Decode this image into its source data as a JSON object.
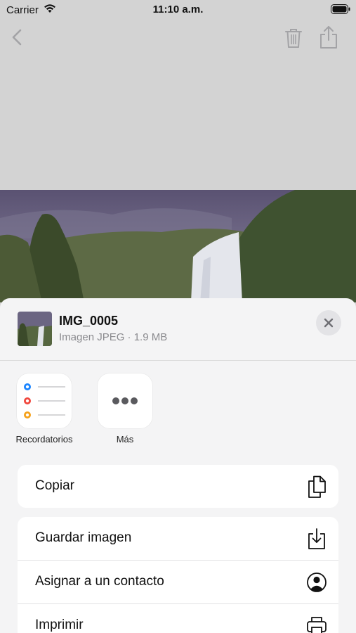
{
  "status_bar": {
    "carrier": "Carrier",
    "time": "11:10 a.m."
  },
  "navbar": {
    "back_icon": "chevron-left-icon",
    "trash_icon": "trash-icon",
    "share_icon": "share-icon"
  },
  "share_sheet": {
    "file_name": "IMG_0005",
    "file_meta": "Imagen JPEG · 1.9 MB",
    "apps": [
      {
        "label": "Recordatorios",
        "icon": "reminders-icon"
      },
      {
        "label": "Más",
        "icon": "more-icon"
      }
    ],
    "actions_group1": [
      {
        "label": "Copiar",
        "icon": "copy-icon"
      }
    ],
    "actions_group2": [
      {
        "label": "Guardar imagen",
        "icon": "save-image-icon"
      },
      {
        "label": "Asignar a un contacto",
        "icon": "contact-icon"
      },
      {
        "label": "Imprimir",
        "icon": "print-icon"
      }
    ]
  },
  "colors": {
    "navbar_icons": "#a3a3a6",
    "sheet_bg": "#f4f4f5",
    "overlay": "#d3d3d3"
  }
}
